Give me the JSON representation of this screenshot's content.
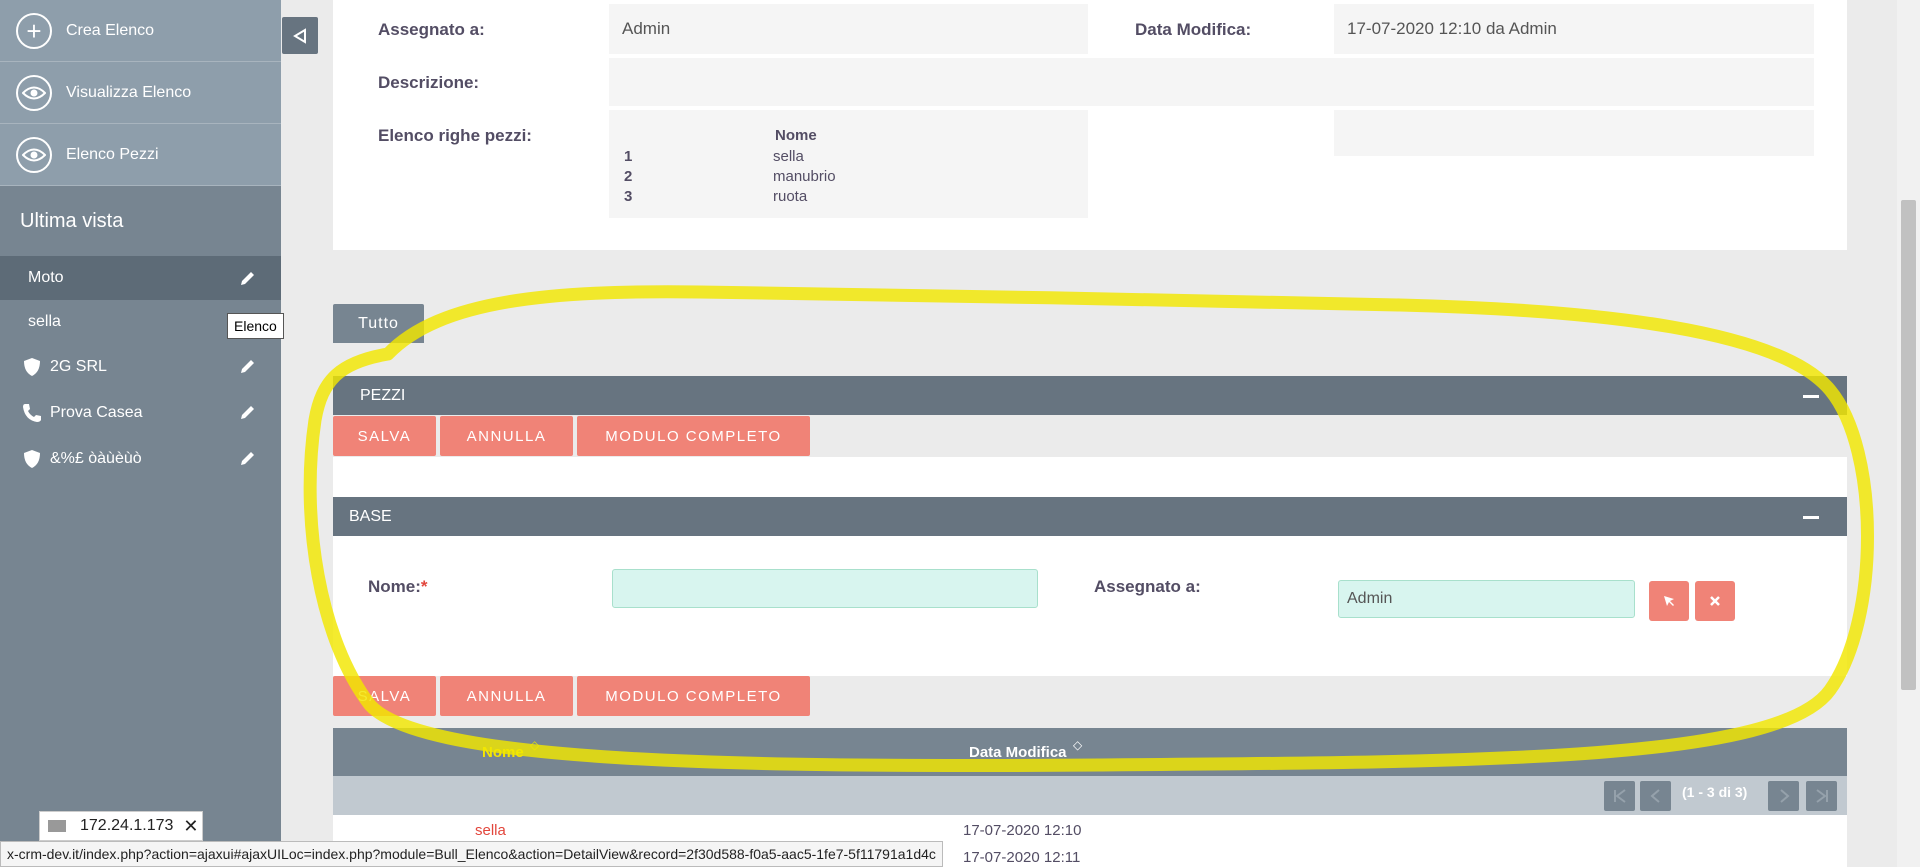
{
  "sidebar": {
    "actions": [
      {
        "label": "Crea Elenco",
        "icon": "plus-icon"
      },
      {
        "label": "Visualizza Elenco",
        "icon": "eye-icon"
      },
      {
        "label": "Elenco Pezzi",
        "icon": "eye-icon"
      }
    ],
    "recent_title": "Ultima vista",
    "recent": [
      {
        "label": "Moto"
      },
      {
        "label": "sella"
      },
      {
        "label": "2G SRL"
      },
      {
        "label": "Prova Casea"
      },
      {
        "label": "&%£ òàùèùò"
      }
    ],
    "tooltip": "Elenco"
  },
  "detail": {
    "assigned_label": "Assegnato a:",
    "assigned_value": "Admin",
    "modified_label": "Data Modifica:",
    "modified_value": "17-07-2020 12:10 da Admin",
    "description_label": "Descrizione:",
    "rows_label": "Elenco righe pezzi:",
    "rows_header": "Nome",
    "rows": [
      {
        "num": "1",
        "name": "sella"
      },
      {
        "num": "2",
        "name": "manubrio"
      },
      {
        "num": "3",
        "name": "ruota"
      }
    ]
  },
  "tab_all": "Tutto",
  "pezzi": {
    "header": "PEZZI",
    "save": "SALVA",
    "cancel": "ANNULLA",
    "full_form": "MODULO COMPLETO"
  },
  "base": {
    "header": "BASE",
    "name_label": "Nome:",
    "required_mark": "*",
    "assigned_label": "Assegnato a:",
    "assigned_value": "Admin"
  },
  "list": {
    "col_name": "Nome",
    "col_modified": "Data Modifica",
    "pagination": "(1 - 3 di 3)",
    "rows": [
      {
        "name": "sella",
        "modified": "17-07-2020 12:10"
      },
      {
        "name": "",
        "modified": "17-07-2020 12:11"
      }
    ]
  },
  "status_url": "x-crm-dev.it/index.php?action=ajaxui#ajaxUILoc=index.php?module=Bull_Elenco&action=DetailView&record=2f30d588-f0a5-aac5-1fe7-5f11791a1d4c",
  "connection_chip": "172.24.1.173",
  "colors": {
    "sidebar": "#778591",
    "panel_header": "#677480",
    "button": "#f08377",
    "input_bg": "#d8f5ef",
    "list_highlight": "#f5e500",
    "link": "#e2463c"
  }
}
